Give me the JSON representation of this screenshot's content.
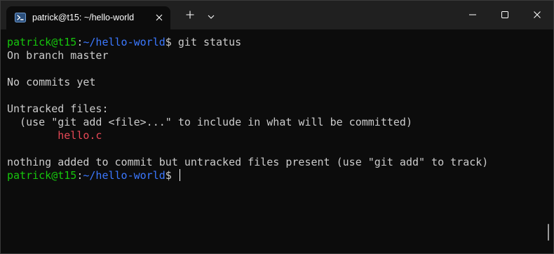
{
  "window": {
    "tab_title": "patrick@t15: ~/hello-world",
    "tab_icon": "powershell-icon",
    "new_tab_icon": "plus-icon",
    "dropdown_icon": "chevron-down-icon",
    "controls": [
      "minimize-icon",
      "maximize-icon",
      "close-icon"
    ]
  },
  "colors": {
    "background": "#0c0c0c",
    "titlebar": "#202020",
    "prompt_user": "#16c60c",
    "prompt_path": "#3b78ff",
    "text": "#cccccc",
    "untracked": "#e74856"
  },
  "terminal": {
    "prompt1": {
      "user": "patrick@t15",
      "colon": ":",
      "path": "~/hello-world",
      "dollar": "$ ",
      "command": "git status"
    },
    "output": {
      "branch": "On branch master",
      "no_commits": "No commits yet",
      "untracked_header": "Untracked files:",
      "hint": "  (use \"git add <file>...\" to include in what will be committed)",
      "untracked_file": "        hello.c",
      "summary": "nothing added to commit but untracked files present (use \"git add\" to track)"
    },
    "prompt2": {
      "user": "patrick@t15",
      "colon": ":",
      "path": "~/hello-world",
      "dollar": "$ "
    }
  }
}
